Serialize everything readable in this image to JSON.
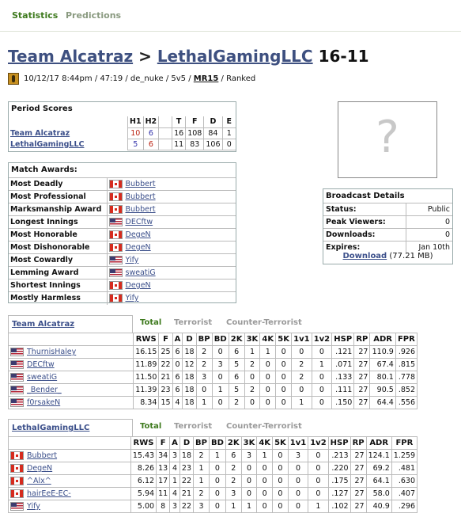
{
  "nav": {
    "statistics": "Statistics",
    "predictions": "Predictions"
  },
  "match": {
    "team1": "Team Alcatraz",
    "separator": ">",
    "team2": "LethalGamingLLC",
    "score": "16-11",
    "meta_prefix": "10/12/17 8:44pm / 47:19 / de_nuke / 5v5 /",
    "format": "MR15",
    "meta_suffix": "/ Ranked"
  },
  "period_scores": {
    "title": "Period Scores",
    "headers": [
      "H1",
      "H2",
      "",
      "T",
      "F",
      "D",
      "E"
    ],
    "rows": [
      {
        "team": "Team Alcatraz",
        "cells": [
          "10",
          "6",
          "",
          "16",
          "108",
          "84",
          "1"
        ]
      },
      {
        "team": "LethalGamingLLC",
        "cells": [
          "5",
          "6",
          "",
          "11",
          "83",
          "106",
          "0"
        ]
      }
    ]
  },
  "awards": {
    "title": "Match Awards:",
    "rows": [
      {
        "award": "Most Deadly",
        "flag": "ca",
        "player": "Bubbert"
      },
      {
        "award": "Most Professional",
        "flag": "ca",
        "player": "Bubbert"
      },
      {
        "award": "Marksmanship Award",
        "flag": "ca",
        "player": "Bubbert"
      },
      {
        "award": "Longest Innings",
        "flag": "us",
        "player": "DECftw"
      },
      {
        "award": "Most Honorable",
        "flag": "ca",
        "player": "DegeN"
      },
      {
        "award": "Most Dishonorable",
        "flag": "ca",
        "player": "DegeN"
      },
      {
        "award": "Most Cowardly",
        "flag": "us",
        "player": "Yify"
      },
      {
        "award": "Lemming Award",
        "flag": "us",
        "player": "sweatiG"
      },
      {
        "award": "Shortest Innings",
        "flag": "ca",
        "player": "DegeN"
      },
      {
        "award": "Mostly Harmless",
        "flag": "ca",
        "player": "Yify"
      }
    ]
  },
  "placeholder": {
    "glyph": "?"
  },
  "broadcast": {
    "title": "Broadcast Details",
    "rows": [
      {
        "key": "Status:",
        "value": "Public"
      },
      {
        "key": "Peak Viewers:",
        "value": "0"
      },
      {
        "key": "Downloads:",
        "value": "0"
      },
      {
        "key": "Expires:",
        "value": "Jan 10th"
      }
    ],
    "download_label": "Download",
    "download_size": "(77.21 MB)"
  },
  "stat_tabs": {
    "total": "Total",
    "terrorist": "Terrorist",
    "ct": "Counter-Terrorist"
  },
  "columns": [
    "RWS",
    "F",
    "A",
    "D",
    "BP",
    "BD",
    "2K",
    "3K",
    "4K",
    "5K",
    "1v1",
    "1v2",
    "HSP",
    "RP",
    "ADR",
    "FPR"
  ],
  "teams": [
    {
      "name": "Team Alcatraz",
      "players": [
        {
          "flag": "us",
          "name": "ThurnisHaley",
          "stats": [
            "16.15",
            "25",
            "6",
            "18",
            "2",
            "0",
            "6",
            "1",
            "1",
            "0",
            "0",
            "0",
            ".121",
            "27",
            "110.9",
            ".926"
          ]
        },
        {
          "flag": "us",
          "name": "DECftw",
          "stats": [
            "11.89",
            "22",
            "0",
            "12",
            "2",
            "3",
            "5",
            "2",
            "0",
            "0",
            "2",
            "1",
            ".071",
            "27",
            "67.4",
            ".815"
          ]
        },
        {
          "flag": "us",
          "name": "sweatiG",
          "stats": [
            "11.50",
            "21",
            "6",
            "18",
            "3",
            "0",
            "6",
            "0",
            "0",
            "0",
            "2",
            "0",
            ".133",
            "27",
            "80.1",
            ".778"
          ]
        },
        {
          "flag": "us",
          "name": "_Bender_",
          "stats": [
            "11.39",
            "23",
            "6",
            "18",
            "0",
            "1",
            "5",
            "2",
            "0",
            "0",
            "0",
            "0",
            ".111",
            "27",
            "90.5",
            ".852"
          ]
        },
        {
          "flag": "us",
          "name": "f0rsakeN",
          "stats": [
            "8.34",
            "15",
            "4",
            "18",
            "1",
            "0",
            "2",
            "0",
            "0",
            "0",
            "1",
            "0",
            ".150",
            "27",
            "64.4",
            ".556"
          ]
        }
      ]
    },
    {
      "name": "LethalGamingLLC",
      "players": [
        {
          "flag": "ca",
          "name": "Bubbert",
          "stats": [
            "15.43",
            "34",
            "3",
            "18",
            "2",
            "1",
            "6",
            "3",
            "1",
            "0",
            "3",
            "0",
            ".213",
            "27",
            "124.1",
            "1.259"
          ]
        },
        {
          "flag": "ca",
          "name": "DegeN",
          "stats": [
            "8.26",
            "13",
            "4",
            "23",
            "1",
            "0",
            "2",
            "0",
            "0",
            "0",
            "0",
            "0",
            ".220",
            "27",
            "69.2",
            ".481"
          ]
        },
        {
          "flag": "ca",
          "name": "^Alx^",
          "stats": [
            "6.12",
            "17",
            "1",
            "22",
            "1",
            "0",
            "2",
            "0",
            "0",
            "0",
            "0",
            "0",
            ".175",
            "27",
            "64.1",
            ".630"
          ]
        },
        {
          "flag": "ca",
          "name": "hairEeE-EC-",
          "stats": [
            "5.94",
            "11",
            "4",
            "21",
            "2",
            "0",
            "3",
            "0",
            "0",
            "0",
            "0",
            "0",
            ".127",
            "27",
            "58.0",
            ".407"
          ]
        },
        {
          "flag": "us",
          "name": "Yify",
          "stats": [
            "5.00",
            "8",
            "3",
            "22",
            "3",
            "0",
            "1",
            "1",
            "0",
            "0",
            "0",
            "1",
            ".102",
            "27",
            "40.9",
            ".296"
          ]
        }
      ]
    }
  ]
}
